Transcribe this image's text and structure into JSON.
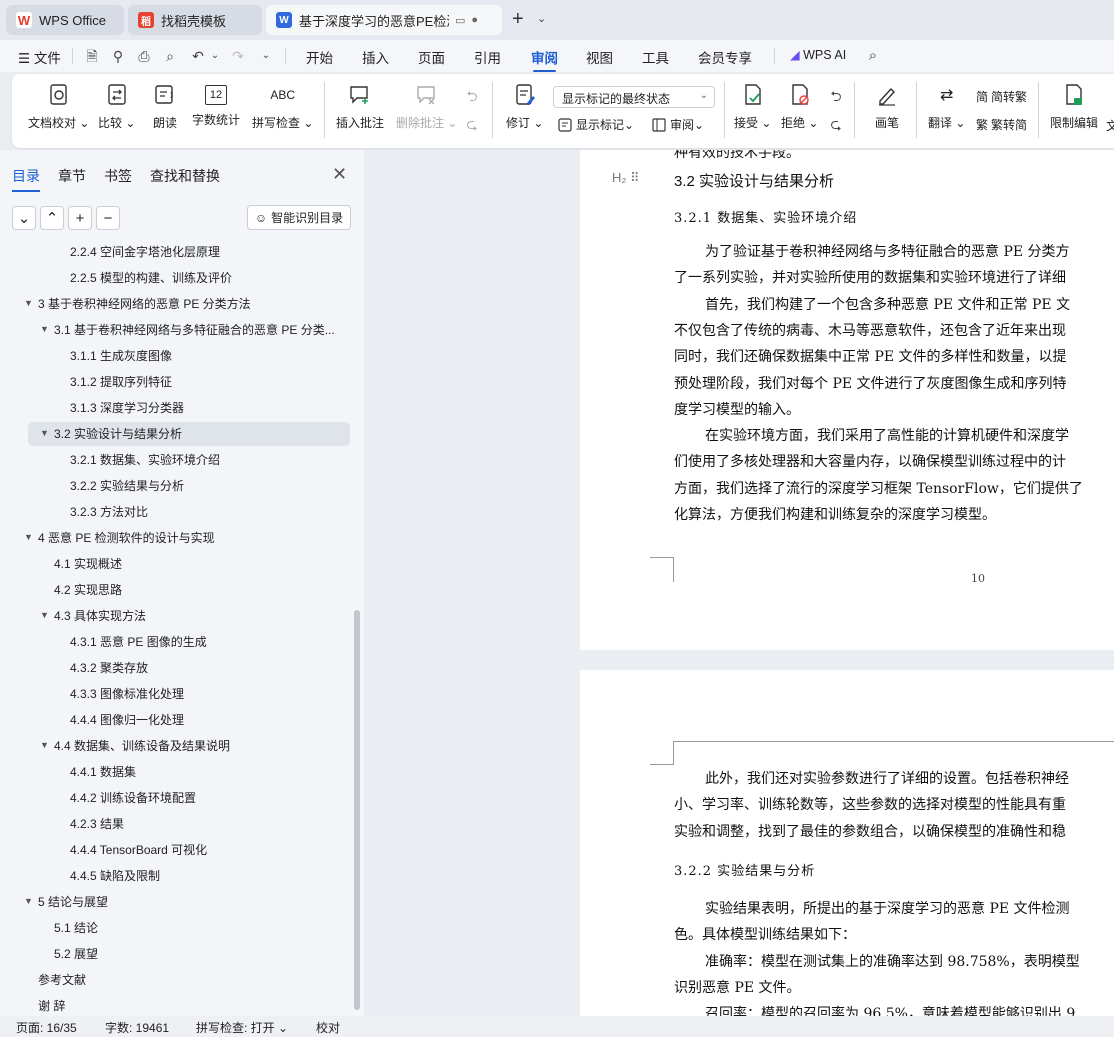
{
  "tabs": [
    {
      "label": "WPS Office",
      "icon": "wps-logo-icon"
    },
    {
      "label": "找稻壳模板",
      "icon": "docer-icon"
    },
    {
      "label": "基于深度学习的恶意PE检测软",
      "icon": "writer-doc-icon"
    }
  ],
  "menu": {
    "file": "文件",
    "items": [
      "开始",
      "插入",
      "页面",
      "引用",
      "审阅",
      "视图",
      "工具",
      "会员专享"
    ],
    "active": "审阅",
    "wps_ai": "WPS AI"
  },
  "ribbon": {
    "proofread": "文档校对",
    "compare": "比较",
    "read_aloud": "朗读",
    "word_count": "字数统计",
    "spell_check": "拼写检查",
    "insert_comment": "插入批注",
    "delete_comment": "删除批注",
    "revise": "修订",
    "markup_combo": "显示标记的最终状态",
    "show_markup": "显示标记",
    "review_pane": "审阅",
    "accept": "接受",
    "reject": "拒绝",
    "pen": "画笔",
    "translate": "翻译",
    "to_traditional": "简转繁",
    "to_simplified": "繁转简",
    "restrict_edit": "限制编辑",
    "more": "文",
    "wordcount_icon_text": "12",
    "spell_icon_text": "ABC"
  },
  "nav": {
    "tabs": [
      "目录",
      "章节",
      "书签",
      "查找和替换"
    ],
    "smart_toc": "智能识别目录",
    "toc": [
      {
        "label": "2.2.4  空间金字塔池化层原理",
        "level": 3
      },
      {
        "label": "2.2.5  模型的构建、训练及评价",
        "level": 3
      },
      {
        "label": "3  基于卷积神经网络的恶意 PE 分类方法",
        "level": 1,
        "arrow": true
      },
      {
        "label": "3.1  基于卷积神经网络与多特征融合的恶意 PE 分类...",
        "level": 2,
        "arrow": true
      },
      {
        "label": "3.1.1  生成灰度图像",
        "level": 3
      },
      {
        "label": "3.1.2  提取序列特征",
        "level": 3
      },
      {
        "label": "3.1.3  深度学习分类器",
        "level": 3
      },
      {
        "label": "3.2  实验设计与结果分析",
        "level": 2,
        "arrow": true,
        "selected": true
      },
      {
        "label": "3.2.1  数据集、实验环境介绍",
        "level": 3
      },
      {
        "label": "3.2.2  实验结果与分析",
        "level": 3
      },
      {
        "label": "3.2.3  方法对比",
        "level": 3
      },
      {
        "label": "4  恶意 PE 检测软件的设计与实现",
        "level": 1,
        "arrow": true
      },
      {
        "label": "4.1  实现概述",
        "level": 2
      },
      {
        "label": "4.2  实现思路",
        "level": 2
      },
      {
        "label": "4.3 具体实现方法",
        "level": 2,
        "arrow": true
      },
      {
        "label": "4.3.1 恶意 PE 图像的生成",
        "level": 3
      },
      {
        "label": "4.3.2 聚类存放",
        "level": 3
      },
      {
        "label": "4.3.3 图像标准化处理",
        "level": 3
      },
      {
        "label": "4.4.4 图像归一化处理",
        "level": 3
      },
      {
        "label": "4.4 数据集、训练设备及结果说明",
        "level": 2,
        "arrow": true
      },
      {
        "label": "4.4.1 数据集",
        "level": 3
      },
      {
        "label": "4.4.2 训练设备环境配置",
        "level": 3
      },
      {
        "label": "4.2.3  结果",
        "level": 3
      },
      {
        "label": "4.4.4 TensorBoard 可视化",
        "level": 3
      },
      {
        "label": "4.4.5  缺陷及限制",
        "level": 3
      },
      {
        "label": "5  结论与展望",
        "level": 1,
        "arrow": true
      },
      {
        "label": "5.1  结论",
        "level": 2
      },
      {
        "label": "5.2  展望",
        "level": 2
      },
      {
        "label": "参考文献",
        "level": 1
      },
      {
        "label": "谢    辞",
        "level": 1
      }
    ]
  },
  "document": {
    "page1_top": "种有效的技术手段。",
    "heading_32": "3.2  实验设计与结果分析",
    "heading_321": "3.2.1  数据集、实验环境介绍",
    "p1": [
      "为了验证基于卷积神经网络与多特征融合的恶意 PE 分类方",
      "了一系列实验，并对实验所使用的数据集和实验环境进行了详细",
      "首先，我们构建了一个包含多种恶意 PE 文件和正常 PE 文",
      "不仅包含了传统的病毒、木马等恶意软件，还包含了近年来出现",
      "同时，我们还确保数据集中正常 PE 文件的多样性和数量，以提",
      "预处理阶段，我们对每个 PE 文件进行了灰度图像生成和序列特",
      "度学习模型的输入。",
      "在实验环境方面，我们采用了高性能的计算机硬件和深度学",
      "们使用了多核处理器和大容量内存，以确保模型训练过程中的计",
      "方面，我们选择了流行的深度学习框架 TensorFlow，它们提供了",
      "化算法，方便我们构建和训练复杂的深度学习模型。"
    ],
    "page_number": "10",
    "p2": [
      "此外，我们还对实验参数进行了详细的设置。包括卷积神经",
      "小、学习率、训练轮数等，这些参数的选择对模型的性能具有重",
      "实验和调整，找到了最佳的参数组合，以确保模型的准确性和稳"
    ],
    "heading_322": "3.2.2  实验结果与分析",
    "p3": [
      "实验结果表明，所提出的基于深度学习的恶意 PE 文件检测",
      "色。具体模型训练结果如下：",
      "准确率：模型在测试集上的准确率达到 98.758%，表明模型",
      "识别恶意 PE 文件。",
      "召回率：模型的召回率为 96.5%，意味着模型能够识别出 9"
    ]
  },
  "status": {
    "page": "页面: 16/35",
    "words": "字数: 19461",
    "spell": "拼写检查: 打开",
    "proof": "校对"
  }
}
